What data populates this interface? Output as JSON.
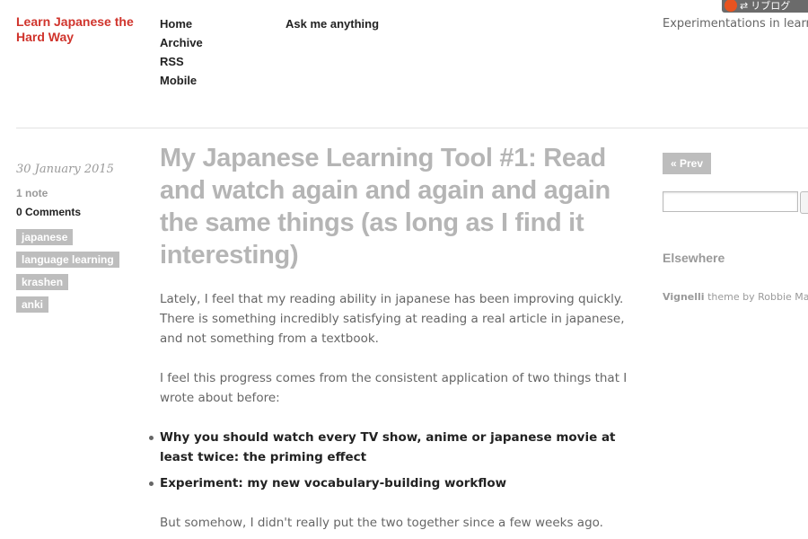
{
  "header": {
    "blog_title": "Learn Japanese the Hard Way",
    "nav_left": [
      "Home",
      "Archive",
      "RSS",
      "Mobile"
    ],
    "nav_right": [
      "Ask me anything"
    ],
    "tagline": "Experimentations in learning japanese faster",
    "reblog_label": "リブログ"
  },
  "post": {
    "date": "30 January 2015",
    "notes": "1 note",
    "comments": "0 Comments",
    "tags": [
      "japanese",
      "language learning",
      "krashen",
      "anki"
    ],
    "title": "My Japanese Learning Tool #1: Read and watch again and again and again the same things (as long as I find it interesting)",
    "paragraph_1": "Lately, I feel that my reading ability in japanese has been improving quickly. There is something incredibly satisfying at reading a real article in japanese, and not something from a textbook.",
    "paragraph_2": "I feel this progress comes from the consistent application of two things that I wrote about before:",
    "links": [
      "Why you should watch every TV show, anime or japanese movie at least twice: the priming effect",
      "Experiment: my new vocabulary-building workflow"
    ],
    "paragraph_3": "But somehow, I didn't really put the two together since a few weeks ago."
  },
  "sidebar": {
    "prev_label": "« Prev",
    "search_value": "",
    "elsewhere_heading": "Elsewhere",
    "credit_theme": "Vignelli",
    "credit_text": " theme by Robbie Manson"
  },
  "colors": {
    "brand_red": "#d0342c",
    "title_gray": "#b5b5b5",
    "tag_gray": "#bdbdbd",
    "text_gray": "#666666"
  }
}
